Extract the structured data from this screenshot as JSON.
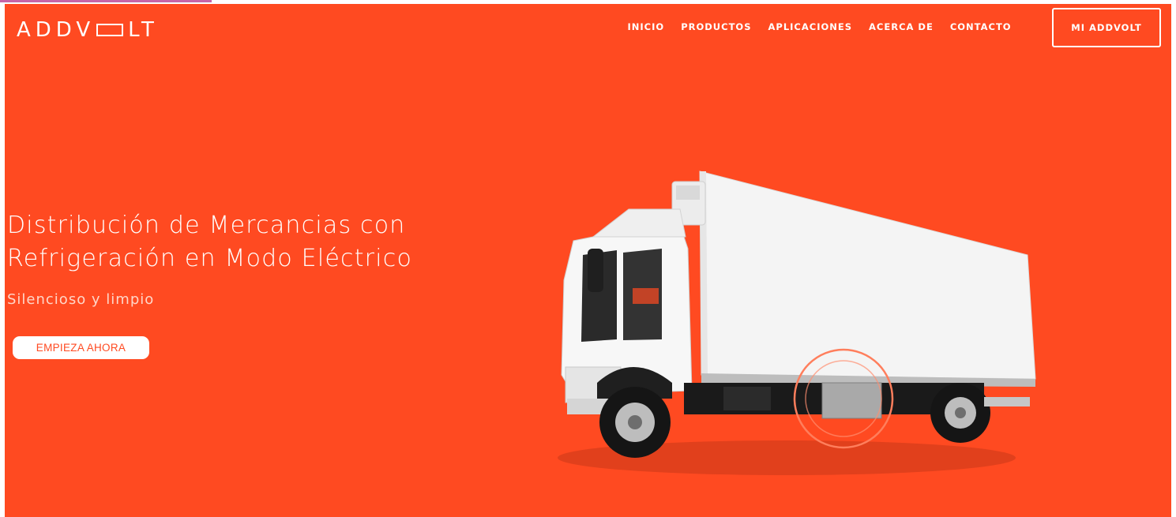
{
  "header": {
    "logo": {
      "prefix": "ADDV",
      "suffix": "LT",
      "full_name": "ADDVOLT"
    },
    "nav": [
      {
        "label": "INICIO"
      },
      {
        "label": "PRODUCTOS"
      },
      {
        "label": "APLICACIONES"
      },
      {
        "label": "ACERCA DE"
      },
      {
        "label": "CONTACTO"
      }
    ],
    "account_button": "MI ADDVOLT"
  },
  "hero": {
    "headline_line1": "Distribución de Mercancias con",
    "headline_line2": "Refrigeración en Modo Eléctrico",
    "subheadline": "Silencioso y limpio",
    "cta_label": "EMPIEZA AHORA"
  },
  "colors": {
    "accent": "#ff4a21",
    "text_on_accent": "#ffffff",
    "top_tab": "#c765a8"
  },
  "icons": {
    "logo_box": "rectangle-o-logo-glyph",
    "truck_image": "refrigerated-truck-illustration"
  }
}
